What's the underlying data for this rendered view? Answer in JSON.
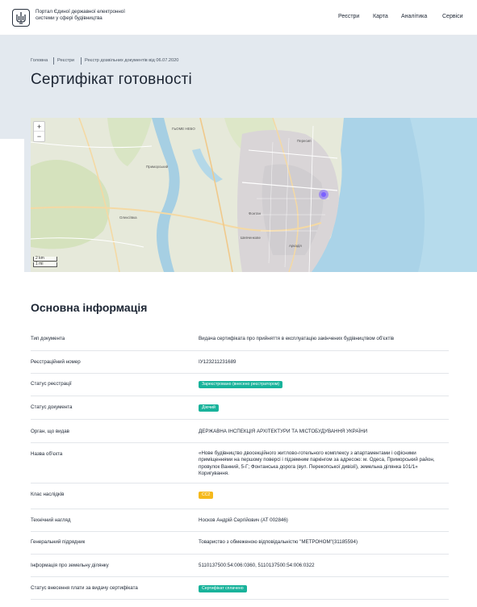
{
  "header": {
    "logo_text": "Портал Єдиної державної електронної системи у сфері будівництва",
    "nav": [
      "Реєстри",
      "Карта",
      "Аналітика",
      "Сервіси"
    ]
  },
  "breadcrumb": [
    "Головна",
    "Реєстри",
    "Реєстр дозвільних документів від 06.07.2020"
  ],
  "page_title": "Сертифікат готовності",
  "map": {
    "zoom_in": "+",
    "zoom_out": "−",
    "scale_km": "2 km",
    "scale_mi": "1 mi",
    "labels": [
      "ГЬОМЕ НЕБО",
      "Пересип",
      "Приморський",
      "Фонтан",
      "Олексіївка",
      "Аркадія",
      "Шевченкове"
    ]
  },
  "section_title": "Основна інформація",
  "rows": [
    {
      "label": "Тип документа",
      "value": "Видача сертифіката про прийняття в експлуатацію закінчених будівництвом об'єктів"
    },
    {
      "label": "Реєстраційний номер",
      "value": "ІУ123211231689"
    },
    {
      "label": "Статус реєстрації",
      "badge": "Зареєстровано (внесено реєстратором)"
    },
    {
      "label": "Статус документа",
      "badge": "Діючий"
    },
    {
      "label": "Орган, що видав",
      "value": "ДЕРЖАВНА ІНСПЕКЦІЯ АРХІТЕКТУРИ ТА МІСТОБУДУВАННЯ УКРАЇНИ"
    },
    {
      "label": "Назва об'єкта",
      "value": "«Нове будівництво двосекційного житлово-готельного комплексу з апартаментами і офісними приміщеннями на першому поверсі і підземним паркінгом за адресою: м. Одеса, Приморський район, провулок Ванний, 5-Г; Фонтанська дорога (вул. Перекопської дивізії), земельна ділянка 101/1» Коригування."
    },
    {
      "label": "Клас наслідків",
      "badge": "СС2"
    },
    {
      "label": "Технічний нагляд",
      "value": "Носков Андрій Сергійович (АТ 002846)"
    },
    {
      "label": "Генеральний підрядник",
      "value": "Товариство з обмеженою відповідальністю \"МЕТРОНОМ\"(31185594)"
    },
    {
      "label": "Інформація про земельну ділянку",
      "value": "5110137500:54:006:0360, 5110137500:54:006:0322"
    },
    {
      "label": "Статус внесення плати за видачу сертифіката",
      "badge": "Сертифікат сплачено"
    }
  ],
  "colors": {
    "hero_bg": "#e3e9ef",
    "badge_green": "#19b39b",
    "badge_yellow": "#f5b91c",
    "sea": "#a9d5ea",
    "marker": "#7b61ff"
  },
  "icons": [
    "trident-icon",
    "map-marker-icon"
  ]
}
